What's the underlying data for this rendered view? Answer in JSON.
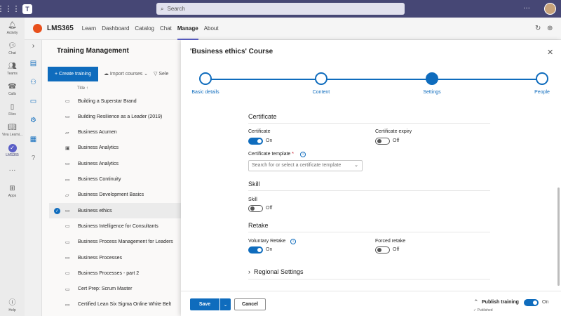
{
  "topbar": {
    "search_placeholder": "Search",
    "more_label": "···"
  },
  "rail": {
    "items": [
      {
        "label": "Activity",
        "icon": "bell-icon"
      },
      {
        "label": "Chat",
        "icon": "chat-icon"
      },
      {
        "label": "Teams",
        "icon": "teams-icon"
      },
      {
        "label": "Calls",
        "icon": "phone-icon"
      },
      {
        "label": "Files",
        "icon": "file-icon"
      },
      {
        "label": "Viva Learni...",
        "icon": "learning-icon"
      },
      {
        "label": "LMS365",
        "icon": "lms365-icon"
      },
      {
        "label": "···",
        "icon": "more-icon"
      },
      {
        "label": "Apps",
        "icon": "apps-icon"
      },
      {
        "label": "Help",
        "icon": "help-icon"
      }
    ]
  },
  "apphead": {
    "name": "LMS365",
    "tabs": [
      "Learn",
      "Dashboard",
      "Catalog",
      "Chat",
      "Manage",
      "About"
    ],
    "active_tab": "Manage"
  },
  "list": {
    "title": "Training Management",
    "create_label": "Create training",
    "import_label": "Import courses",
    "select_label": "Sele",
    "column_title": "Title ↑",
    "rows": [
      {
        "title": "Building a Superstar Brand",
        "icon": "course-icon",
        "selected": false
      },
      {
        "title": "Building Resilience as a Leader (2019)",
        "icon": "course-icon",
        "selected": false
      },
      {
        "title": "Business Acumen",
        "icon": "folder-icon",
        "selected": false
      },
      {
        "title": "Business Analytics",
        "icon": "person-card-icon",
        "selected": false
      },
      {
        "title": "Business Analytics",
        "icon": "course-icon",
        "selected": false
      },
      {
        "title": "Business Continuity",
        "icon": "course-icon",
        "selected": false
      },
      {
        "title": "Business Development Basics",
        "icon": "folder-icon",
        "selected": false
      },
      {
        "title": "Business ethics",
        "icon": "course-icon",
        "selected": true
      },
      {
        "title": "Business Intelligence for Consultants",
        "icon": "course-icon",
        "selected": false
      },
      {
        "title": "Business Process Management for Leaders",
        "icon": "course-icon",
        "selected": false
      },
      {
        "title": "Business Processes",
        "icon": "course-icon",
        "selected": false
      },
      {
        "title": "Business Processes - part 2",
        "icon": "course-icon",
        "selected": false
      },
      {
        "title": "Cert Prep: Scrum Master",
        "icon": "course-icon",
        "selected": false
      },
      {
        "title": "Certified Lean Six Sigma Online White Belt",
        "icon": "course-icon",
        "selected": false
      }
    ]
  },
  "panel": {
    "title": "'Business ethics' Course",
    "steps": [
      "Basic details",
      "Content",
      "Settings",
      "People"
    ],
    "current_step": "Settings",
    "certificate": {
      "heading": "Certificate",
      "certificate_label": "Certificate",
      "certificate_state": "On",
      "expiry_label": "Certificate expiry",
      "expiry_state": "Off",
      "template_label": "Certificate template",
      "template_required": "*",
      "template_placeholder": "Search for or select a certificate template"
    },
    "skill": {
      "heading": "Skill",
      "skill_label": "Skill",
      "skill_state": "Off"
    },
    "retake": {
      "heading": "Retake",
      "voluntary_label": "Voluntary Retake",
      "voluntary_state": "On",
      "forced_label": "Forced retake",
      "forced_state": "Off"
    },
    "regional_label": "Regional Settings",
    "footer": {
      "save_label": "Save",
      "cancel_label": "Cancel",
      "publish_label": "Publish training",
      "publish_state": "On",
      "published_status": "Published"
    }
  },
  "colors": {
    "brand": "#464775",
    "accent": "#0f6cbd",
    "lms_logo": "#e8501c"
  }
}
